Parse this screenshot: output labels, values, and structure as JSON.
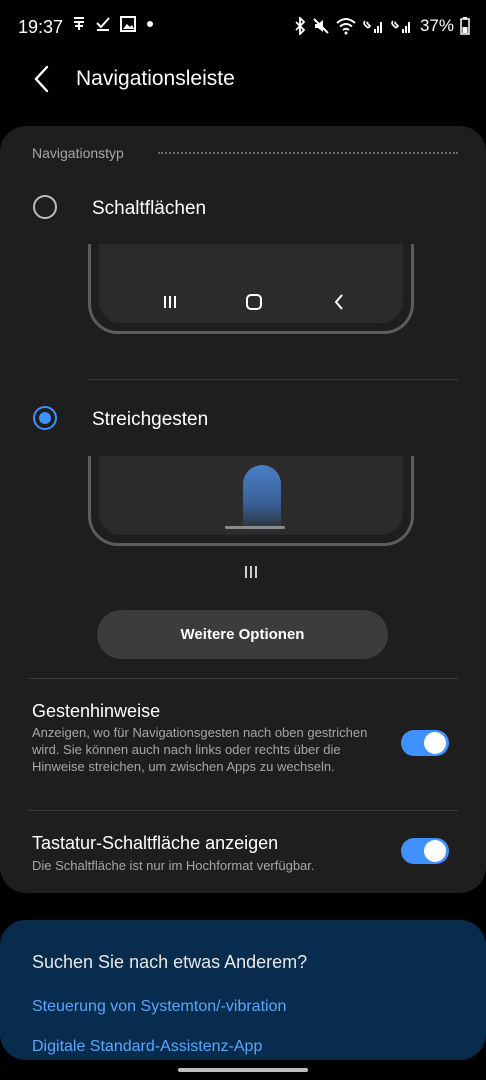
{
  "status_bar": {
    "time": "19:37",
    "battery_percent": "37%",
    "left_icons": [
      "data-saver-icon",
      "check-download-icon",
      "gallery-icon",
      "dot-icon"
    ],
    "right_icons": [
      "bluetooth-icon",
      "mute-icon",
      "wifi-icon",
      "signal-1-icon",
      "signal-2-icon",
      "battery-icon"
    ]
  },
  "header": {
    "title": "Navigationsleiste",
    "back_icon": "back-chevron-icon"
  },
  "navigation_type": {
    "section_title": "Navigationstyp",
    "options": [
      {
        "label": "Schaltflächen",
        "selected": false
      },
      {
        "label": "Streichgesten",
        "selected": true
      }
    ],
    "more_options_label": "Weitere Optionen"
  },
  "settings": [
    {
      "title": "Gestenhinweise",
      "description": "Anzeigen, wo für Navigationsgesten nach oben gestrichen wird. Sie können auch nach links oder rechts über die Hinweise streichen, um zwischen Apps zu wechseln.",
      "enabled": true
    },
    {
      "title": "Tastatur-Schaltfläche anzeigen",
      "description": "Die Schaltfläche ist nur im Hochformat verfügbar.",
      "enabled": true
    }
  ],
  "suggestions": {
    "heading": "Suchen Sie nach etwas Anderem?",
    "links": [
      "Steuerung von Systemton/-vibration",
      "Digitale Standard-Assistenz-App"
    ]
  },
  "colors": {
    "accent": "#3e91ff",
    "card": "#1e1e1e",
    "suggestion_card": "#082c4e",
    "link": "#5aa6ff"
  }
}
